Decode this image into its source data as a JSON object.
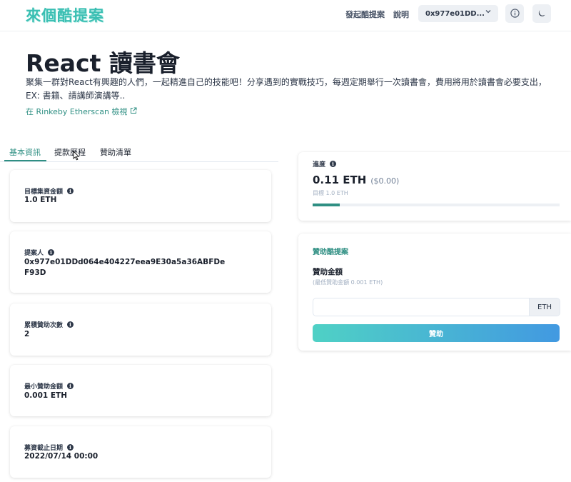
{
  "header": {
    "logo": "來個酷提案",
    "nav_create": "發起酷提案",
    "nav_help": "說明",
    "wallet_address": "0x977e01DD...",
    "icons": [
      "info-circle-icon",
      "moon-icon",
      "chevron-down-icon"
    ]
  },
  "project": {
    "title": "React 讀書會",
    "description": "聚集一群對React有興趣的人們，一起精進自己的技能吧！分享遇到的實戰技巧，每週定期舉行一次讀書會，費用將用於讀書會必要支出，EX: 書籍、請講師演講等..",
    "etherscan_link": "在 Rinkeby Etherscan 檢視"
  },
  "tabs": [
    {
      "label": "基本資訊",
      "active": true
    },
    {
      "label": "提款歷程",
      "active": false
    },
    {
      "label": "贊助清單",
      "active": false
    }
  ],
  "info_cards": {
    "target": {
      "label": "目標集資金額",
      "value": "1.0 ETH"
    },
    "proposer": {
      "label": "提案人",
      "value_line1": "0x977e01DDd064e404227eea9E30a5a36ABFDe",
      "value_line2": "F93D"
    },
    "count": {
      "label": "累積贊助次數",
      "value": "2"
    },
    "min_amount": {
      "label": "最小贊助金額",
      "value": "0.001 ETH"
    },
    "deadline": {
      "label": "募資截止日期",
      "value": "2022/07/14 00:00"
    }
  },
  "progress": {
    "label": "進度",
    "amount": "0.11 ETH",
    "fiat": "($0.00)",
    "target_text": "目標 1.0 ETH",
    "fraction": 0.11
  },
  "sponsor_form": {
    "title": "贊助酷提案",
    "field_label": "贊助金額",
    "hint": "(最低贊助金額 0.001 ETH)",
    "input_value": "",
    "addon": "ETH",
    "button": "贊助"
  },
  "colors": {
    "brand": "#3bbfb3",
    "accent": "#2f8f83",
    "gradient_start": "#4fd1c5",
    "gradient_end": "#4299e1"
  }
}
